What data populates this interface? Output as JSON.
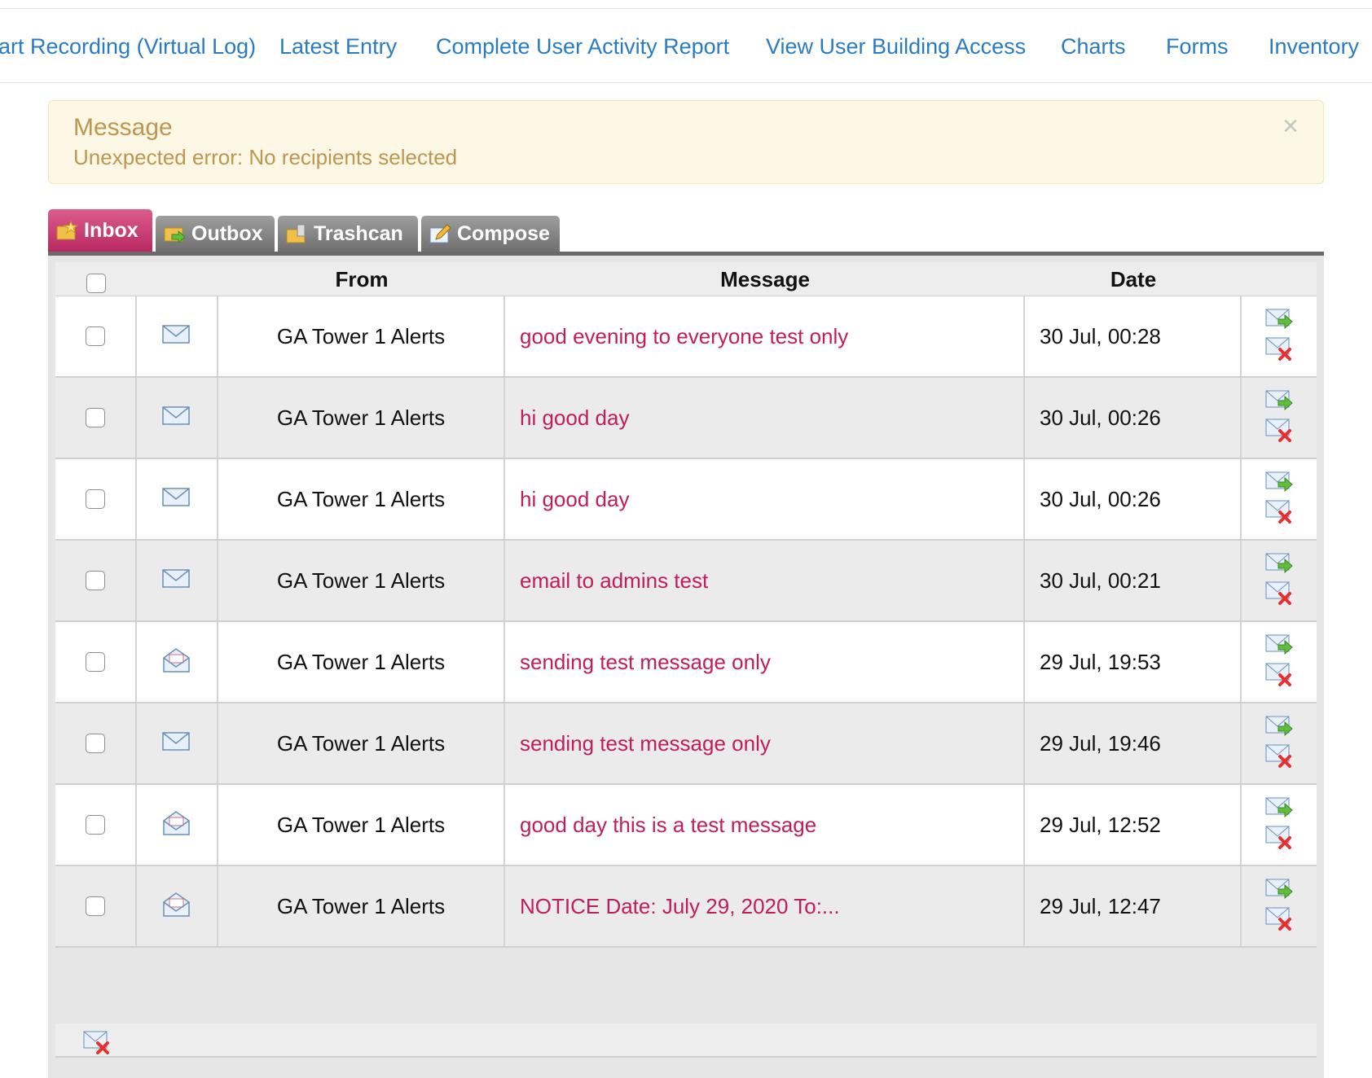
{
  "nav": {
    "items": [
      "art Recording (Virtual Log)",
      "Latest Entry",
      "Complete User Activity Report",
      "View User Building Access",
      "Charts",
      "Forms",
      "Inventory"
    ]
  },
  "alert": {
    "title": "Message",
    "text": "Unexpected error: No recipients selected",
    "close": "×"
  },
  "tabs": [
    {
      "label": "Inbox",
      "active": true
    },
    {
      "label": "Outbox",
      "active": false
    },
    {
      "label": "Trashcan",
      "active": false
    },
    {
      "label": "Compose",
      "active": false
    }
  ],
  "table": {
    "headers": {
      "from": "From",
      "message": "Message",
      "date": "Date"
    },
    "rows": [
      {
        "status": "unread",
        "from": "GA Tower 1 Alerts",
        "message": "good evening to everyone test only",
        "date": "30 Jul, 00:28"
      },
      {
        "status": "unread",
        "from": "GA Tower 1 Alerts",
        "message": "hi good day",
        "date": "30 Jul, 00:26"
      },
      {
        "status": "unread",
        "from": "GA Tower 1 Alerts",
        "message": "hi good day",
        "date": "30 Jul, 00:26"
      },
      {
        "status": "unread",
        "from": "GA Tower 1 Alerts",
        "message": "email to admins test",
        "date": "30 Jul, 00:21"
      },
      {
        "status": "read",
        "from": "GA Tower 1 Alerts",
        "message": "sending test message only",
        "date": "29 Jul, 19:53"
      },
      {
        "status": "unread",
        "from": "GA Tower 1 Alerts",
        "message": "sending test message only",
        "date": "29 Jul, 19:46"
      },
      {
        "status": "read",
        "from": "GA Tower 1 Alerts",
        "message": "good day this is a test message",
        "date": "29 Jul, 12:52"
      },
      {
        "status": "read",
        "from": "GA Tower 1 Alerts",
        "message": "NOTICE Date: July 29, 2020 To:...",
        "date": "29 Jul, 12:47"
      }
    ]
  },
  "colors": {
    "link": "#2a7bc2",
    "message_link": "#bf1d5c",
    "alert_text": "#bf964f",
    "alert_bg": "#fcf8e5",
    "tab_active": "#c7336b",
    "tab_inactive": "#8a8a8a"
  }
}
